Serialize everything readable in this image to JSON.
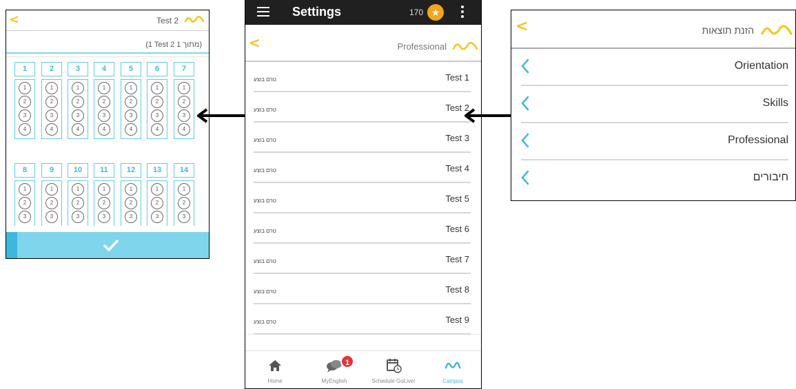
{
  "colors": {
    "accent": "#3fb7dc",
    "accent_light": "#7fd5ec",
    "back_arrow": "#f5c518",
    "topbar": "#202020",
    "badge": "#e63434",
    "star": "#f4a51c"
  },
  "left_panel": {
    "title": "Test 2",
    "subtitle": "(1 Test 2 מתוך 1)",
    "back_icon": "chevron-left-icon",
    "logo_icon": "campus-logo-icon",
    "questions_row1": [
      "1",
      "2",
      "3",
      "4",
      "5",
      "6",
      "7"
    ],
    "questions_row2": [
      "8",
      "9",
      "10",
      "11",
      "12",
      "13",
      "14"
    ],
    "options": [
      "1",
      "2",
      "3",
      "4"
    ],
    "confirm_icon": "checkmark-icon"
  },
  "middle_panel": {
    "app_title": "Settings",
    "points": "170",
    "star_icon": "star-icon",
    "menu_icon": "hamburger-icon",
    "more_icon": "kebab-menu-icon",
    "section_title": "Professional",
    "tests": [
      {
        "name": "Test 1",
        "status": "טרם בוצע"
      },
      {
        "name": "Test 2",
        "status": "טרם בוצע"
      },
      {
        "name": "Test 3",
        "status": "טרם בוצע"
      },
      {
        "name": "Test 4",
        "status": "טרם בוצע"
      },
      {
        "name": "Test 5",
        "status": "טרם בוצע"
      },
      {
        "name": "Test 6",
        "status": "טרם בוצע"
      },
      {
        "name": "Test 7",
        "status": "טרם בוצע"
      },
      {
        "name": "Test 8",
        "status": "טרם בוצע"
      },
      {
        "name": "Test 9",
        "status": "טרם בוצע"
      }
    ],
    "nav": [
      {
        "label": "Home",
        "icon": "home-icon"
      },
      {
        "label": "MyEnglish",
        "icon": "chat-bubbles-icon",
        "badge": "1"
      },
      {
        "label": "Schedule GoLive!",
        "icon": "calendar-clock-icon"
      },
      {
        "label": "Campus",
        "icon": "campus-logo-icon",
        "active": true
      }
    ]
  },
  "right_panel": {
    "title": "הזנת תוצאות",
    "items": [
      "Orientation",
      "Skills",
      "Professional",
      "חיבורים"
    ]
  }
}
